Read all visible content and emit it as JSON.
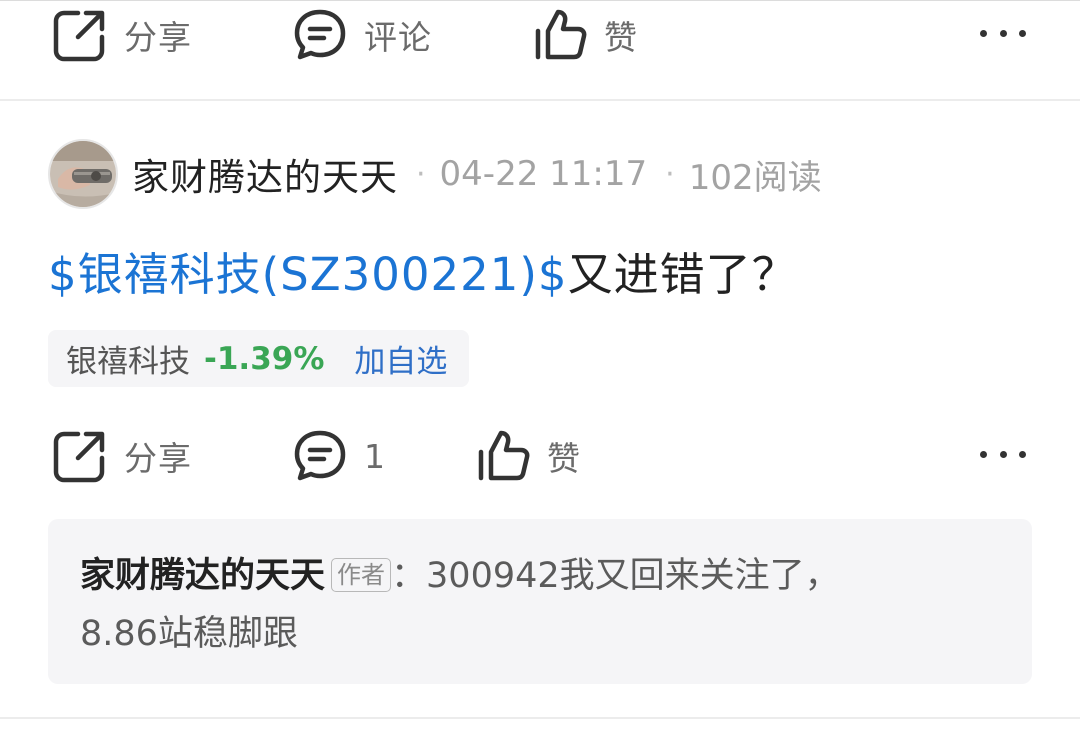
{
  "top_bar": {
    "share_label": "分享",
    "comment_label": "评论",
    "like_label": "赞"
  },
  "post": {
    "author": "家财腾达的天天",
    "date": "04-22 11:17",
    "reads": "102阅读",
    "title_link": "$银禧科技(SZ300221)$",
    "title_text": "又进错了？",
    "stock": {
      "name": "银禧科技",
      "change": "-1.39%",
      "add_label": "加自选"
    },
    "actions": {
      "share_label": "分享",
      "comment_count": "1",
      "like_label": "赞"
    },
    "comment": {
      "author": "家财腾达的天天",
      "badge": "作者",
      "colon": "：",
      "text_line1": "300942我又回来关注了，",
      "text_line2": "8.86站稳脚跟"
    }
  },
  "icons": [
    "share-icon",
    "comment-icon",
    "like-icon",
    "more-icon"
  ],
  "colors": {
    "link": "#1b74d4",
    "down": "#3aa655",
    "add": "#2f6fc7"
  }
}
